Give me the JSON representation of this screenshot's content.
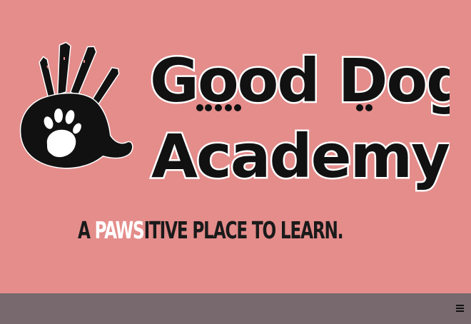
{
  "colors": {
    "hero_background": "#e48d8b",
    "footer_background": "#77696e",
    "logo_ink": "#111111",
    "highlight": "#ffffff"
  },
  "brand": {
    "line1": "Good Dog",
    "line2": "Academy",
    "icon": "handprint-with-paw-icon"
  },
  "tagline": {
    "prefix": "A ",
    "highlight": "PAWS",
    "suffix": "ITIVE PLACE TO LEARN."
  },
  "footer": {
    "menu_icon": "hamburger-menu-icon"
  }
}
